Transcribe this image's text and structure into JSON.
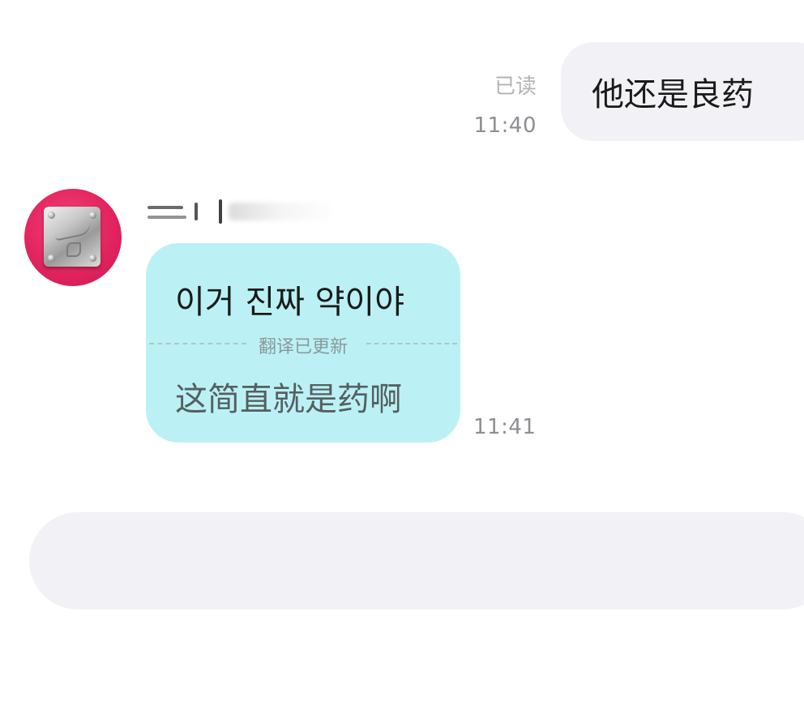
{
  "outgoing_message": {
    "text": "他还是良药",
    "read_status": "已读",
    "time": "11:40"
  },
  "incoming_message": {
    "original_text": "이거 진짜 약이야",
    "translation_label": "翻译已更新",
    "translated_text": "这简直就是药啊",
    "time": "11:41"
  },
  "colors": {
    "outgoing_bubble": "#f2f2f6",
    "incoming_bubble": "#bbf1f4",
    "avatar_bg": "#e3245f",
    "timestamp": "#8e8e93"
  }
}
